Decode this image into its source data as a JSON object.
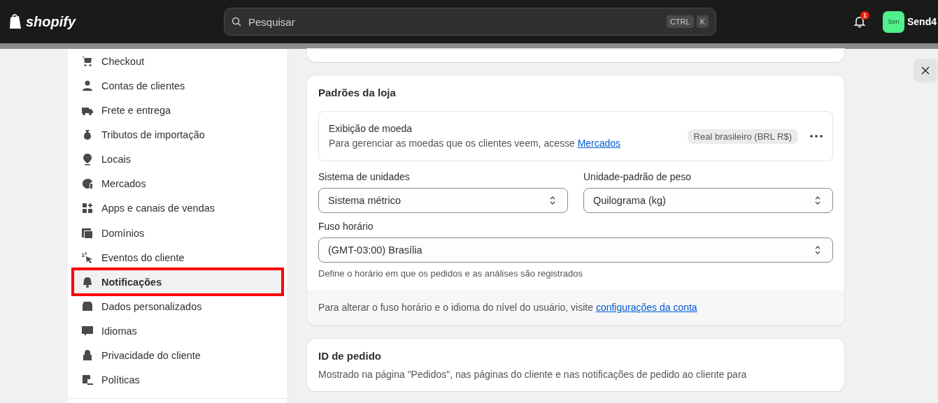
{
  "topbar": {
    "logo": "shopify",
    "search": {
      "placeholder": "Pesquisar",
      "shortcut": [
        "CTRL",
        "K"
      ]
    },
    "notifications": {
      "count": "1"
    },
    "account": {
      "avatar": "Sen",
      "name": "Send4"
    }
  },
  "sidebar": {
    "items": [
      {
        "label": "Checkout",
        "selected": false,
        "highlighted": false
      },
      {
        "label": "Contas de clientes",
        "selected": false,
        "highlighted": false
      },
      {
        "label": "Frete e entrega",
        "selected": false,
        "highlighted": false
      },
      {
        "label": "Tributos de importação",
        "selected": false,
        "highlighted": false
      },
      {
        "label": "Locais",
        "selected": false,
        "highlighted": false
      },
      {
        "label": "Mercados",
        "selected": false,
        "highlighted": false
      },
      {
        "label": "Apps e canais de vendas",
        "selected": false,
        "highlighted": false
      },
      {
        "label": "Domínios",
        "selected": false,
        "highlighted": false
      },
      {
        "label": "Eventos do cliente",
        "selected": false,
        "highlighted": false
      },
      {
        "label": "Notificações",
        "selected": true,
        "highlighted": true
      },
      {
        "label": "Dados personalizados",
        "selected": false,
        "highlighted": false
      },
      {
        "label": "Idiomas",
        "selected": false,
        "highlighted": false
      },
      {
        "label": "Privacidade do cliente",
        "selected": false,
        "highlighted": false
      },
      {
        "label": "Políticas",
        "selected": false,
        "highlighted": false
      }
    ]
  },
  "store_defaults": {
    "title": "Padrões da loja",
    "currency": {
      "label": "Exibição de moeda",
      "description": "Para gerenciar as moedas que os clientes veem, acesse",
      "link": "Mercados",
      "badge": "Real brasileiro (BRL R$)"
    },
    "selects": [
      {
        "label": "Sistema de unidades",
        "value": "Sistema métrico"
      },
      {
        "label": "Unidade-padrão de peso",
        "value": "Quilograma (kg)"
      }
    ],
    "timezone": {
      "label": "Fuso horário",
      "value": "(GMT-03:00) Brasília",
      "help": "Define o horário em que os pedidos e as análises são registrados"
    },
    "footer": {
      "text": "Para alterar o fuso horário e o idioma do nível do usuário, visite",
      "link": "configurações da conta"
    }
  },
  "order_id": {
    "title": "ID de pedido",
    "description": "Mostrado na página \"Pedidos\", nas páginas do cliente e nas notificações de pedido ao cliente para"
  }
}
